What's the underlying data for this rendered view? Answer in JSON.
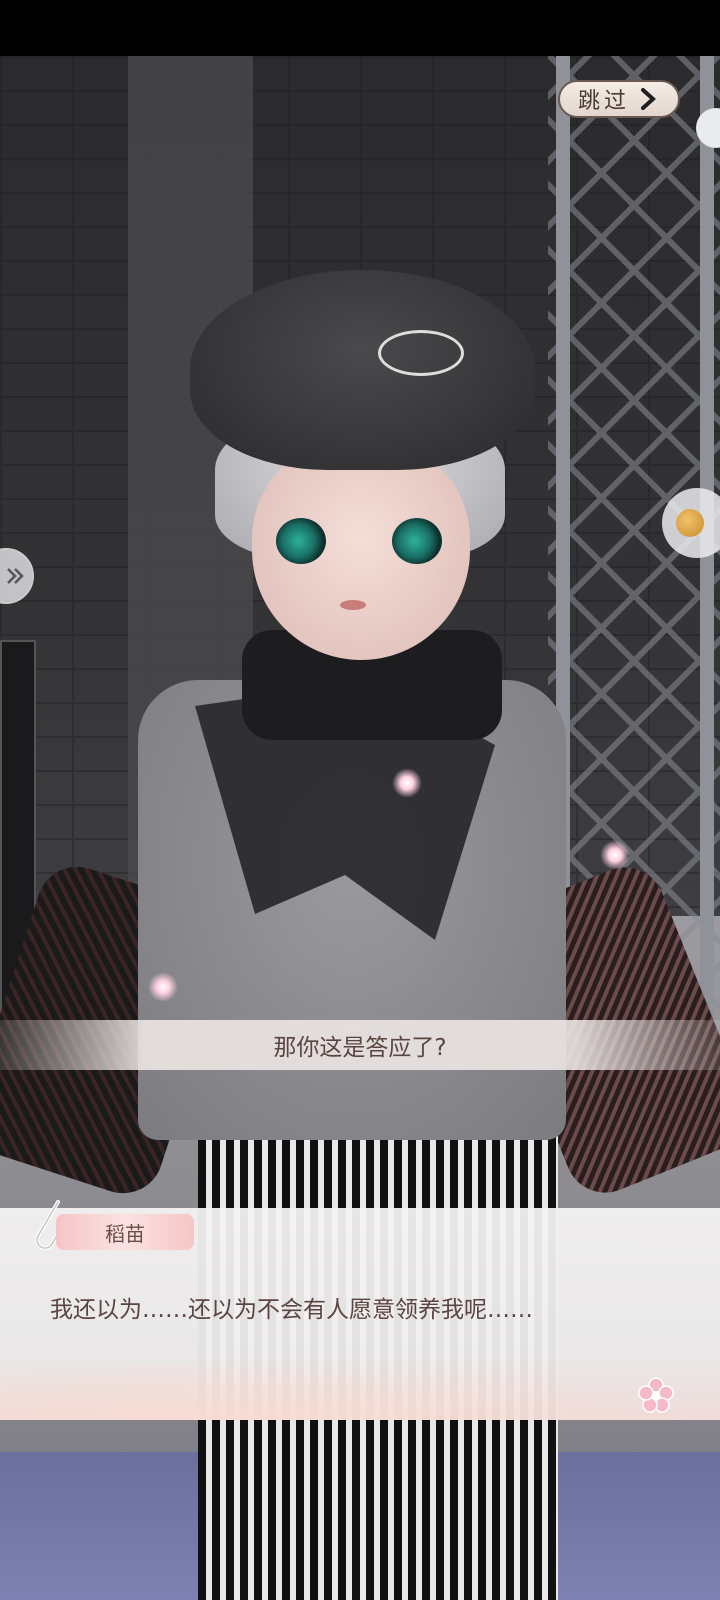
{
  "header": {
    "skip_label": "跳过"
  },
  "prompt": {
    "text": "那你这是答应了?"
  },
  "dialogue": {
    "speaker": "稻苗",
    "line": "我还以为……还以为不会有人愿意领养我呢……"
  },
  "colors": {
    "nameplate": "#f6c5c6",
    "dialogue_text": "#5a4540",
    "skip_border": "#6b5a52"
  },
  "icons": {
    "skip": "chevron-right-icon",
    "clip": "paperclip-icon",
    "continue": "sakura-icon",
    "left_side": "double-chevron-icon",
    "right_side": "coin-icon"
  }
}
